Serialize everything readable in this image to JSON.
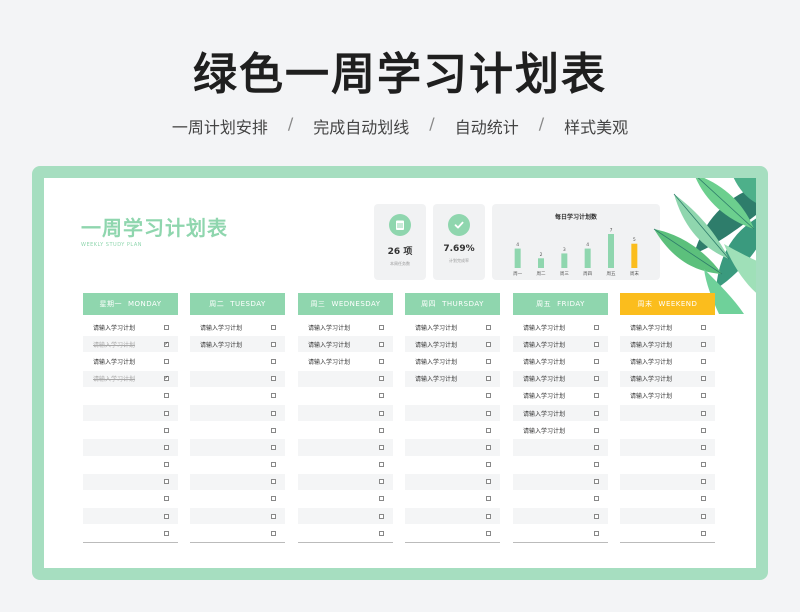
{
  "page": {
    "title": "绿色一周学习计划表",
    "subtitle_items": [
      "一周计划安排",
      "完成自动划线",
      "自动统计",
      "样式美观"
    ],
    "subtitle_separator": "/"
  },
  "sheet": {
    "title": "一周学习计划表",
    "subtitle": "WEEKLY STUDY PLAN",
    "accent": "#8fd6ae",
    "weekend_accent": "#fbbd1d"
  },
  "stats": [
    {
      "icon": "clipboard-icon",
      "value": "26 项",
      "label": "本周任务数"
    },
    {
      "icon": "check-circle-icon",
      "value": "7.69%",
      "label": "计划完成率"
    }
  ],
  "chart_data": {
    "type": "bar",
    "title": "每日学习计划数",
    "categories": [
      "周一",
      "周二",
      "周三",
      "周四",
      "周五",
      "周末"
    ],
    "values": [
      4,
      2,
      3,
      4,
      7,
      5
    ],
    "colors": [
      "#8fd6ae",
      "#8fd6ae",
      "#8fd6ae",
      "#8fd6ae",
      "#8fd6ae",
      "#fbbd1d"
    ]
  },
  "placeholder_task": "请输入学习计划",
  "days": [
    {
      "cn": "星期一",
      "en": "MONDAY",
      "weekend": false,
      "tasks": [
        {
          "text": "请输入学习计划",
          "done": false
        },
        {
          "text": "请输入学习计划",
          "done": true
        },
        {
          "text": "请输入学习计划",
          "done": false
        },
        {
          "text": "请输入学习计划",
          "done": true
        }
      ]
    },
    {
      "cn": "周二",
      "en": "TUESDAY",
      "weekend": false,
      "tasks": [
        {
          "text": "请输入学习计划",
          "done": false
        },
        {
          "text": "请输入学习计划",
          "done": false
        }
      ]
    },
    {
      "cn": "周三",
      "en": "WEDNESDAY",
      "weekend": false,
      "tasks": [
        {
          "text": "请输入学习计划",
          "done": false
        },
        {
          "text": "请输入学习计划",
          "done": false
        },
        {
          "text": "请输入学习计划",
          "done": false
        }
      ]
    },
    {
      "cn": "周四",
      "en": "THURSDAY",
      "weekend": false,
      "tasks": [
        {
          "text": "请输入学习计划",
          "done": false
        },
        {
          "text": "请输入学习计划",
          "done": false
        },
        {
          "text": "请输入学习计划",
          "done": false
        },
        {
          "text": "请输入学习计划",
          "done": false
        }
      ]
    },
    {
      "cn": "周五",
      "en": "FRIDAY",
      "weekend": false,
      "tasks": [
        {
          "text": "请输入学习计划",
          "done": false
        },
        {
          "text": "请输入学习计划",
          "done": false
        },
        {
          "text": "请输入学习计划",
          "done": false
        },
        {
          "text": "请输入学习计划",
          "done": false
        },
        {
          "text": "请输入学习计划",
          "done": false
        },
        {
          "text": "请输入学习计划",
          "done": false
        },
        {
          "text": "请输入学习计划",
          "done": false
        }
      ]
    },
    {
      "cn": "周末",
      "en": "WEEKEND",
      "weekend": true,
      "tasks": [
        {
          "text": "请输入学习计划",
          "done": false
        },
        {
          "text": "请输入学习计划",
          "done": false
        },
        {
          "text": "请输入学习计划",
          "done": false
        },
        {
          "text": "请输入学习计划",
          "done": false
        },
        {
          "text": "请输入学习计划",
          "done": false
        }
      ]
    }
  ],
  "check_mark": "✓"
}
